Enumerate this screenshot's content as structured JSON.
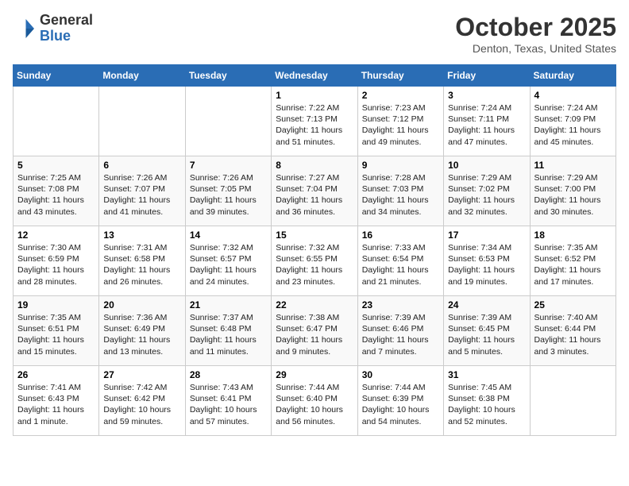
{
  "header": {
    "logo_general": "General",
    "logo_blue": "Blue",
    "month_title": "October 2025",
    "location": "Denton, Texas, United States"
  },
  "weekdays": [
    "Sunday",
    "Monday",
    "Tuesday",
    "Wednesday",
    "Thursday",
    "Friday",
    "Saturday"
  ],
  "weeks": [
    [
      {
        "day": "",
        "info": ""
      },
      {
        "day": "",
        "info": ""
      },
      {
        "day": "",
        "info": ""
      },
      {
        "day": "1",
        "info": "Sunrise: 7:22 AM\nSunset: 7:13 PM\nDaylight: 11 hours\nand 51 minutes."
      },
      {
        "day": "2",
        "info": "Sunrise: 7:23 AM\nSunset: 7:12 PM\nDaylight: 11 hours\nand 49 minutes."
      },
      {
        "day": "3",
        "info": "Sunrise: 7:24 AM\nSunset: 7:11 PM\nDaylight: 11 hours\nand 47 minutes."
      },
      {
        "day": "4",
        "info": "Sunrise: 7:24 AM\nSunset: 7:09 PM\nDaylight: 11 hours\nand 45 minutes."
      }
    ],
    [
      {
        "day": "5",
        "info": "Sunrise: 7:25 AM\nSunset: 7:08 PM\nDaylight: 11 hours\nand 43 minutes."
      },
      {
        "day": "6",
        "info": "Sunrise: 7:26 AM\nSunset: 7:07 PM\nDaylight: 11 hours\nand 41 minutes."
      },
      {
        "day": "7",
        "info": "Sunrise: 7:26 AM\nSunset: 7:05 PM\nDaylight: 11 hours\nand 39 minutes."
      },
      {
        "day": "8",
        "info": "Sunrise: 7:27 AM\nSunset: 7:04 PM\nDaylight: 11 hours\nand 36 minutes."
      },
      {
        "day": "9",
        "info": "Sunrise: 7:28 AM\nSunset: 7:03 PM\nDaylight: 11 hours\nand 34 minutes."
      },
      {
        "day": "10",
        "info": "Sunrise: 7:29 AM\nSunset: 7:02 PM\nDaylight: 11 hours\nand 32 minutes."
      },
      {
        "day": "11",
        "info": "Sunrise: 7:29 AM\nSunset: 7:00 PM\nDaylight: 11 hours\nand 30 minutes."
      }
    ],
    [
      {
        "day": "12",
        "info": "Sunrise: 7:30 AM\nSunset: 6:59 PM\nDaylight: 11 hours\nand 28 minutes."
      },
      {
        "day": "13",
        "info": "Sunrise: 7:31 AM\nSunset: 6:58 PM\nDaylight: 11 hours\nand 26 minutes."
      },
      {
        "day": "14",
        "info": "Sunrise: 7:32 AM\nSunset: 6:57 PM\nDaylight: 11 hours\nand 24 minutes."
      },
      {
        "day": "15",
        "info": "Sunrise: 7:32 AM\nSunset: 6:55 PM\nDaylight: 11 hours\nand 23 minutes."
      },
      {
        "day": "16",
        "info": "Sunrise: 7:33 AM\nSunset: 6:54 PM\nDaylight: 11 hours\nand 21 minutes."
      },
      {
        "day": "17",
        "info": "Sunrise: 7:34 AM\nSunset: 6:53 PM\nDaylight: 11 hours\nand 19 minutes."
      },
      {
        "day": "18",
        "info": "Sunrise: 7:35 AM\nSunset: 6:52 PM\nDaylight: 11 hours\nand 17 minutes."
      }
    ],
    [
      {
        "day": "19",
        "info": "Sunrise: 7:35 AM\nSunset: 6:51 PM\nDaylight: 11 hours\nand 15 minutes."
      },
      {
        "day": "20",
        "info": "Sunrise: 7:36 AM\nSunset: 6:49 PM\nDaylight: 11 hours\nand 13 minutes."
      },
      {
        "day": "21",
        "info": "Sunrise: 7:37 AM\nSunset: 6:48 PM\nDaylight: 11 hours\nand 11 minutes."
      },
      {
        "day": "22",
        "info": "Sunrise: 7:38 AM\nSunset: 6:47 PM\nDaylight: 11 hours\nand 9 minutes."
      },
      {
        "day": "23",
        "info": "Sunrise: 7:39 AM\nSunset: 6:46 PM\nDaylight: 11 hours\nand 7 minutes."
      },
      {
        "day": "24",
        "info": "Sunrise: 7:39 AM\nSunset: 6:45 PM\nDaylight: 11 hours\nand 5 minutes."
      },
      {
        "day": "25",
        "info": "Sunrise: 7:40 AM\nSunset: 6:44 PM\nDaylight: 11 hours\nand 3 minutes."
      }
    ],
    [
      {
        "day": "26",
        "info": "Sunrise: 7:41 AM\nSunset: 6:43 PM\nDaylight: 11 hours\nand 1 minute."
      },
      {
        "day": "27",
        "info": "Sunrise: 7:42 AM\nSunset: 6:42 PM\nDaylight: 10 hours\nand 59 minutes."
      },
      {
        "day": "28",
        "info": "Sunrise: 7:43 AM\nSunset: 6:41 PM\nDaylight: 10 hours\nand 57 minutes."
      },
      {
        "day": "29",
        "info": "Sunrise: 7:44 AM\nSunset: 6:40 PM\nDaylight: 10 hours\nand 56 minutes."
      },
      {
        "day": "30",
        "info": "Sunrise: 7:44 AM\nSunset: 6:39 PM\nDaylight: 10 hours\nand 54 minutes."
      },
      {
        "day": "31",
        "info": "Sunrise: 7:45 AM\nSunset: 6:38 PM\nDaylight: 10 hours\nand 52 minutes."
      },
      {
        "day": "",
        "info": ""
      }
    ]
  ]
}
